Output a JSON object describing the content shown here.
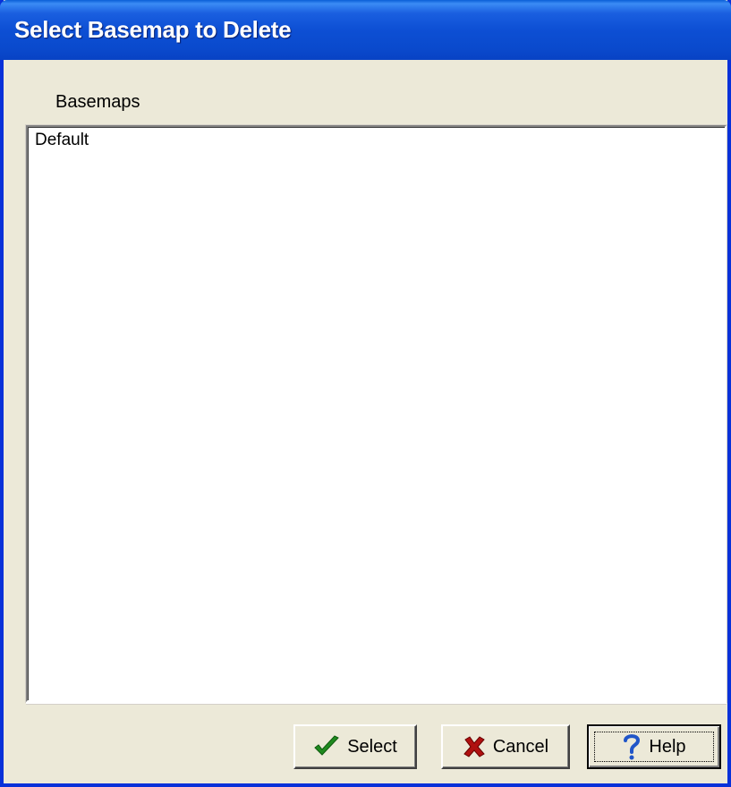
{
  "window": {
    "title": "Select Basemap to Delete"
  },
  "basemaps": {
    "label": "Basemaps",
    "items": [
      "Default"
    ]
  },
  "buttons": {
    "select_label": "Select",
    "cancel_label": "Cancel",
    "help_label": "Help",
    "select_icon": "checkmark-icon",
    "cancel_icon": "x-icon",
    "help_icon": "question-mark-icon"
  },
  "colors": {
    "titlebar": "#0a4acd",
    "window_bg": "#ece9d8",
    "check_green": "#1f8a1f",
    "x_red": "#b01010",
    "help_blue": "#2055c8"
  }
}
